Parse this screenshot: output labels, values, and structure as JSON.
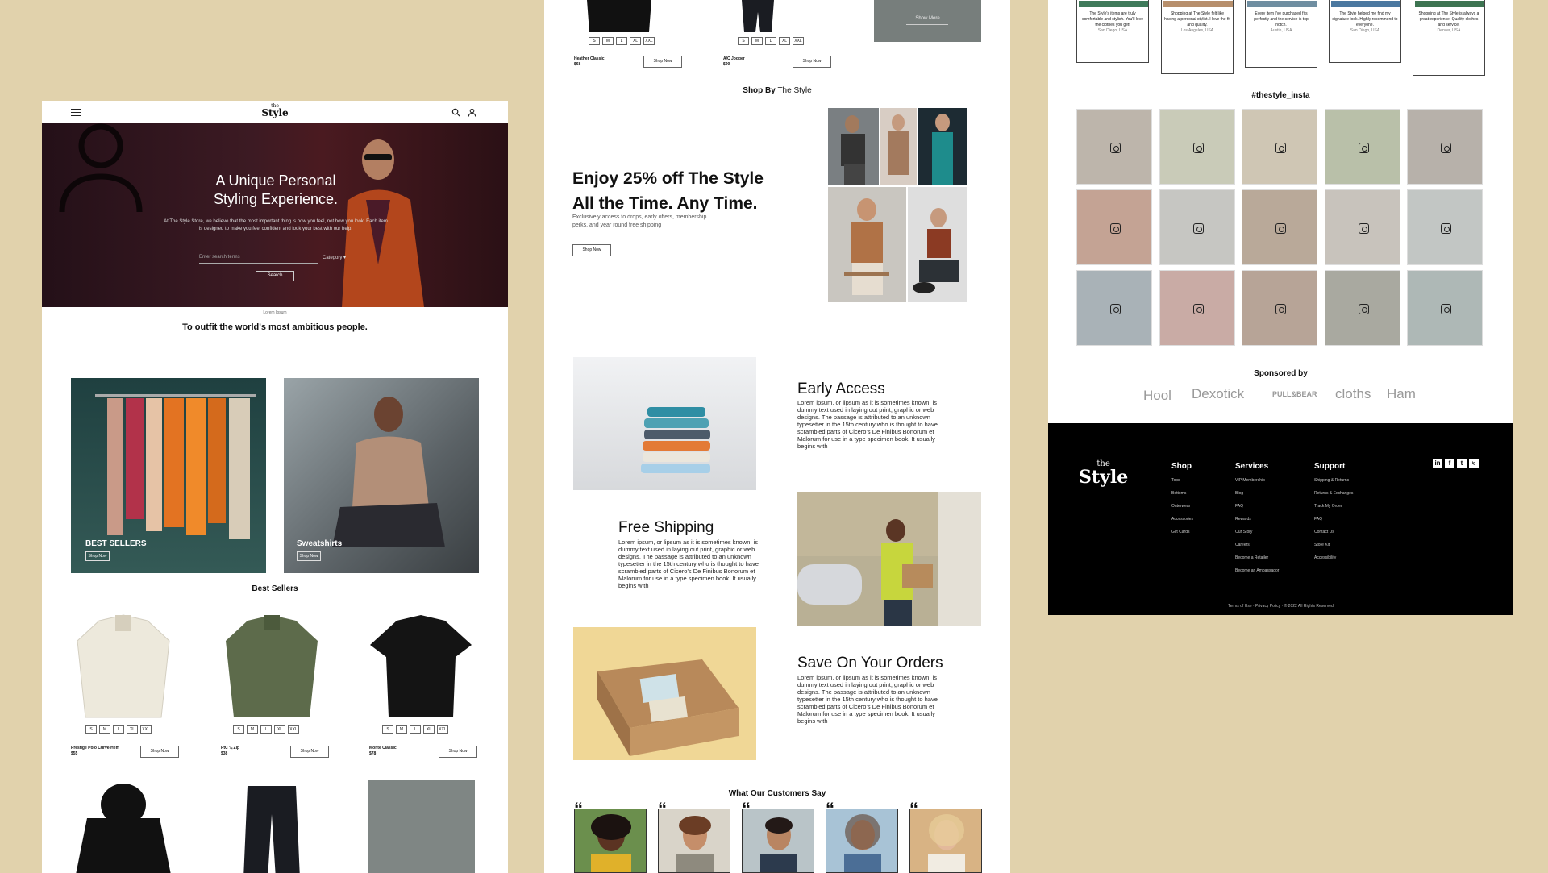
{
  "brand": {
    "the": "the",
    "name": "Style"
  },
  "hero": {
    "title_line1": "A Unique Personal",
    "title_line2": "Styling Experience.",
    "subtitle": "At The Style Store, we believe that the most important thing is how you feel, not how you look. Each item is designed to make you feel confident and look your best with our help.",
    "search_placeholder": "Enter search terms",
    "category_label": "Category",
    "search_button": "Search",
    "caption": "Lorem Ipsum"
  },
  "tagline": "To outfit the world's most ambitious people.",
  "categories": [
    {
      "label": "BEST SELLERS",
      "button": "Shop Now"
    },
    {
      "label": "Sweatshirts",
      "button": "Shop Now"
    }
  ],
  "best_sellers": {
    "title": "Best Sellers",
    "sizes": [
      "S",
      "M",
      "L",
      "XL",
      "XXL"
    ],
    "products": [
      {
        "name": "Prestige Polo Curve-Hem",
        "price": "$55",
        "button": "Shop Now"
      },
      {
        "name": "PtC ¼ Zip",
        "price": "$38",
        "button": "Shop Now"
      },
      {
        "name": "Monte Classic",
        "price": "$78",
        "button": "Shop Now"
      }
    ]
  },
  "top_products": [
    {
      "name": "Heather Classic",
      "price": "$68",
      "button": "Shop Now"
    },
    {
      "name": "A/C Jogger",
      "price": "$90",
      "button": "Shop Now"
    }
  ],
  "show_more": "Show More",
  "shop_by_style": {
    "bold": "Shop By",
    "light": "The Style"
  },
  "promo": {
    "title_line1": "Enjoy 25% off The Style",
    "title_line2": "All the Time. Any Time.",
    "text": "Exclusively access to drops, early offers, membership perks, and year round free shipping",
    "button": "Shop Now"
  },
  "features": [
    {
      "title": "Early Access",
      "text": "Lorem ipsum, or lipsum as it is sometimes known, is dummy text used in laying out print, graphic or web designs. The passage is attributed to an unknown typesetter in the 15th century who is thought to have scrambled parts of Cicero's De Finibus Bonorum et Malorum for use in a type specimen book. It usually begins with"
    },
    {
      "title": "Free Shipping",
      "text": "Lorem ipsum, or lipsum as it is sometimes known, is dummy text used in laying out print, graphic or web designs. The passage is attributed to an unknown typesetter in the 15th century who is thought to have scrambled parts of Cicero's De Finibus Bonorum et Malorum for use in a type specimen book. It usually begins with"
    },
    {
      "title": "Save On Your Orders",
      "text": "Lorem ipsum, or lipsum as it is sometimes known, is dummy text used in laying out print, graphic or web designs. The passage is attributed to an unknown typesetter in the 15th century who is thought to have scrambled parts of Cicero's De Finibus Bonorum et Malorum for use in a type specimen book. It usually begins with"
    }
  ],
  "testimonials_title": "What Our Customers Say",
  "testimonials": [
    {
      "text": "The Style's items are truly comfortable and stylish. You'll love the clothes you get!",
      "author": "San Diego, USA"
    },
    {
      "text": "Shopping at The Style felt like having a personal stylist. I love the fit and quality.",
      "author": "Los Angeles, USA"
    },
    {
      "text": "Every item I've purchased fits perfectly and the service is top notch.",
      "author": "Austin, USA"
    },
    {
      "text": "The Style helped me find my signature look. Highly recommend to everyone.",
      "author": "San Diego, USA"
    },
    {
      "text": "Shopping at The Style is always a great experience. Quality clothes and service.",
      "author": "Denver, USA"
    }
  ],
  "instagram": {
    "title": "#thestyle_insta"
  },
  "sponsors": {
    "title": "Sponsored by",
    "names": [
      "Hool",
      "Dexotick",
      "PULL&BEAR",
      "cloths",
      "Ham"
    ]
  },
  "footer": {
    "columns": [
      {
        "title": "Shop",
        "items": [
          "Tops",
          "Bottoms",
          "Outerwear",
          "Accessories",
          "Gift Cards"
        ]
      },
      {
        "title": "Services",
        "items": [
          "VIP Membership",
          "Blog",
          "FAQ",
          "Rewards",
          "Our Story",
          "Careers",
          "Become a Retailer",
          "Become an Ambassador"
        ]
      },
      {
        "title": "Support",
        "items": [
          "Shipping & Returns",
          "Returns & Exchanges",
          "Track My Order",
          "FAQ",
          "Contact Us",
          "Store Kit",
          "Accessibility"
        ]
      }
    ],
    "social": [
      "in",
      "f",
      "t",
      "ig"
    ],
    "copyright": "Terms of Use · Privacy Policy · © 2022 All Rights Reserved"
  },
  "colors": {
    "page_bg": "#e1d2ac",
    "hero_bg": "#3c1a23",
    "footer_bg": "#000000"
  },
  "icons": [
    "menu-icon",
    "search-icon",
    "user-icon",
    "quote-icon",
    "instagram-icon"
  ]
}
